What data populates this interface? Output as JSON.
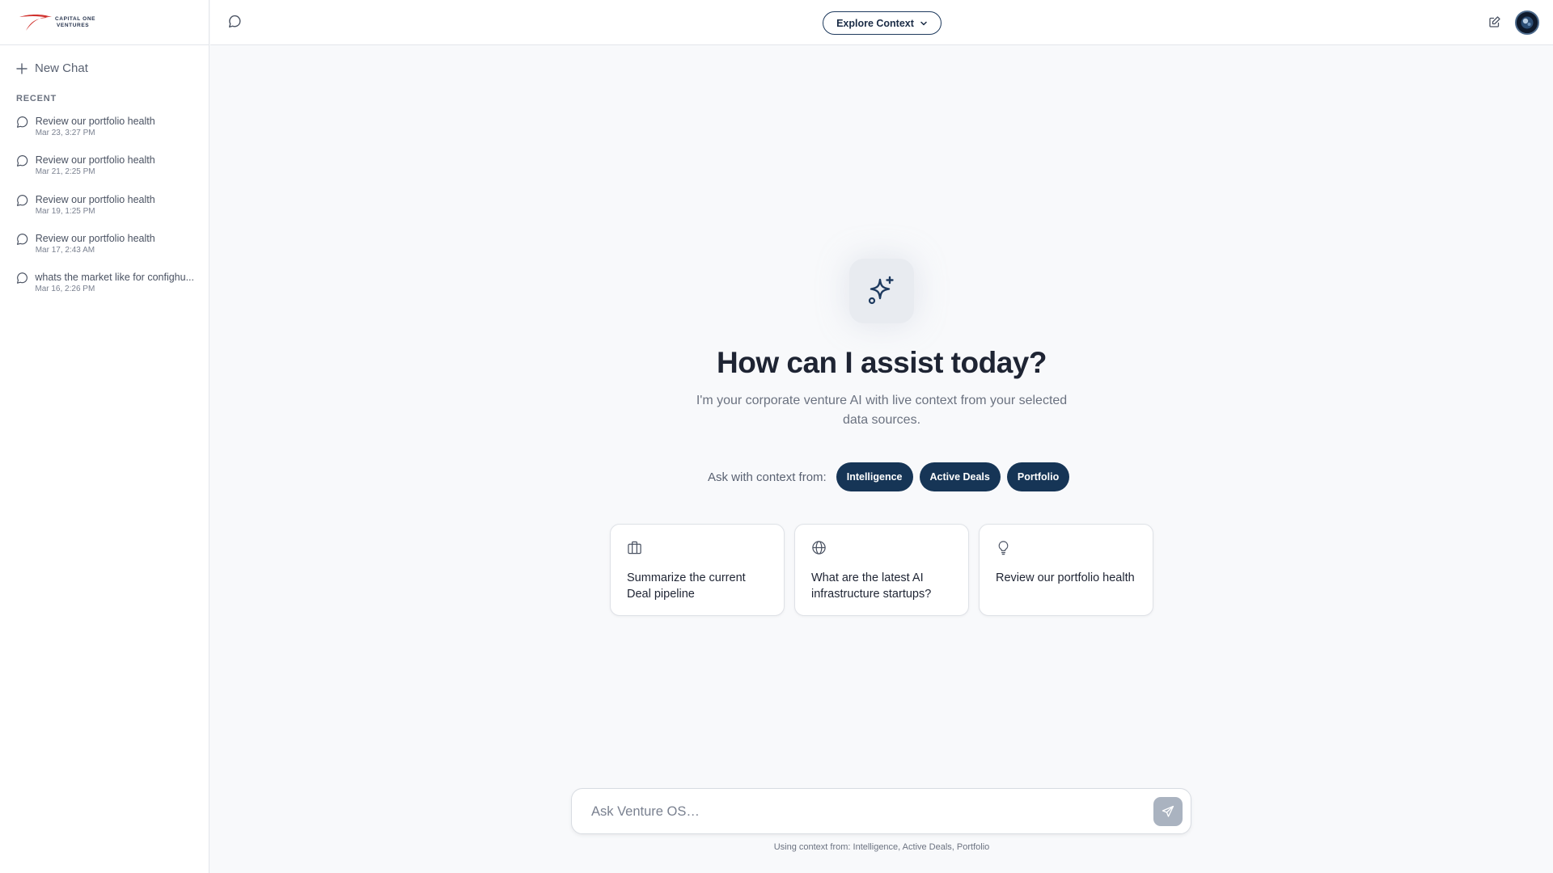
{
  "sidebar": {
    "logo_line1": "CAPITAL ONE",
    "logo_line2": "VENTURES",
    "new_chat_label": "New Chat",
    "recent_label": "RECENT",
    "history": [
      {
        "title": "Review our portfolio health",
        "date": "Mar 23, 3:27 PM"
      },
      {
        "title": "Review our portfolio health",
        "date": "Mar 21, 2:25 PM"
      },
      {
        "title": "Review our portfolio health",
        "date": "Mar 19, 1:25 PM"
      },
      {
        "title": "Review our portfolio health",
        "date": "Mar 17, 2:43 AM"
      },
      {
        "title": "whats the market like for confighu...",
        "date": "Mar 16, 2:26 PM"
      }
    ]
  },
  "header": {
    "explore_label": "Explore Context",
    "icons": {
      "left": "chat-bubble-icon",
      "edit": "edit-icon",
      "caret": "chevron-down-icon"
    }
  },
  "hero": {
    "icon": "sparkles-icon",
    "title": "How can I assist today?",
    "subtitle": "I'm your corporate venture AI with live context from your selected data sources."
  },
  "context": {
    "label": "Ask with context from:",
    "chips": [
      "Intelligence",
      "Active Deals",
      "Portfolio"
    ]
  },
  "cards": [
    {
      "icon": "briefcase-icon",
      "text": "Summarize the current Deal pipeline"
    },
    {
      "icon": "globe-icon",
      "text": "What are the latest AI infrastructure startups?"
    },
    {
      "icon": "lightbulb-icon",
      "text": "Review our portfolio health"
    }
  ],
  "composer": {
    "placeholder": "Ask Venture OS…",
    "send_icon": "send-icon",
    "context_note": "Using context from: Intelligence, Active Deals, Portfolio"
  },
  "colors": {
    "accent": "#163556",
    "logo_red": "#d0312d",
    "background": "#f8f9fb",
    "send_disabled": "#aab3c0"
  }
}
